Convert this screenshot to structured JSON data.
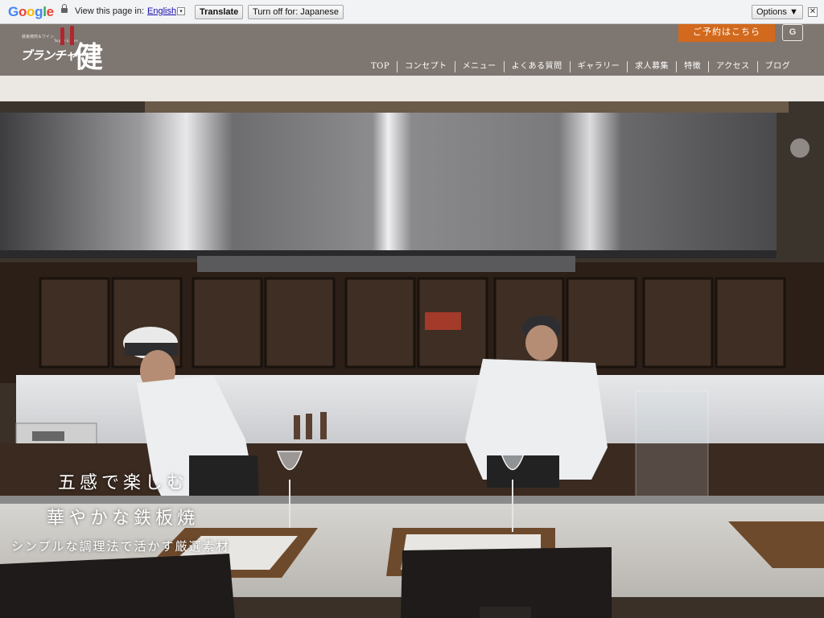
{
  "translate_bar": {
    "logo": [
      "G",
      "o",
      "o",
      "g",
      "l",
      "e"
    ],
    "view_text": "View this page in:",
    "language": "English",
    "dropdown_glyph": "▾",
    "translate_button": "Translate",
    "turnoff_button": "Turn off for: Japanese",
    "options_button": "Options ▼",
    "close_glyph": "✕"
  },
  "header": {
    "logo": {
      "small_text": "鉄板焼肉＆ワイン",
      "small_text2": "Teppan & Wine",
      "kana": "ブランチャー",
      "kanji": "健"
    },
    "reserve_button": "ご予約はこちら",
    "translate_icon": "G",
    "nav": [
      "TOP",
      "コンセプト",
      "メニュー",
      "よくある質問",
      "ギャラリー",
      "求人募集",
      "特徴",
      "アクセス",
      "ブログ"
    ]
  },
  "hero": {
    "line1": "五感で楽しむ",
    "line2": "華やかな鉄板焼",
    "line3": "シンプルな調理法で活かす厳選素材"
  },
  "colors": {
    "header_bg": "#7e7670",
    "reserve_bg": "#d2691c",
    "band_bg": "#ebe7e3",
    "logo_red": "#b1262d"
  },
  "icons": {
    "lock": "lock-icon",
    "close": "close-icon",
    "translate": "google-translate-icon"
  }
}
